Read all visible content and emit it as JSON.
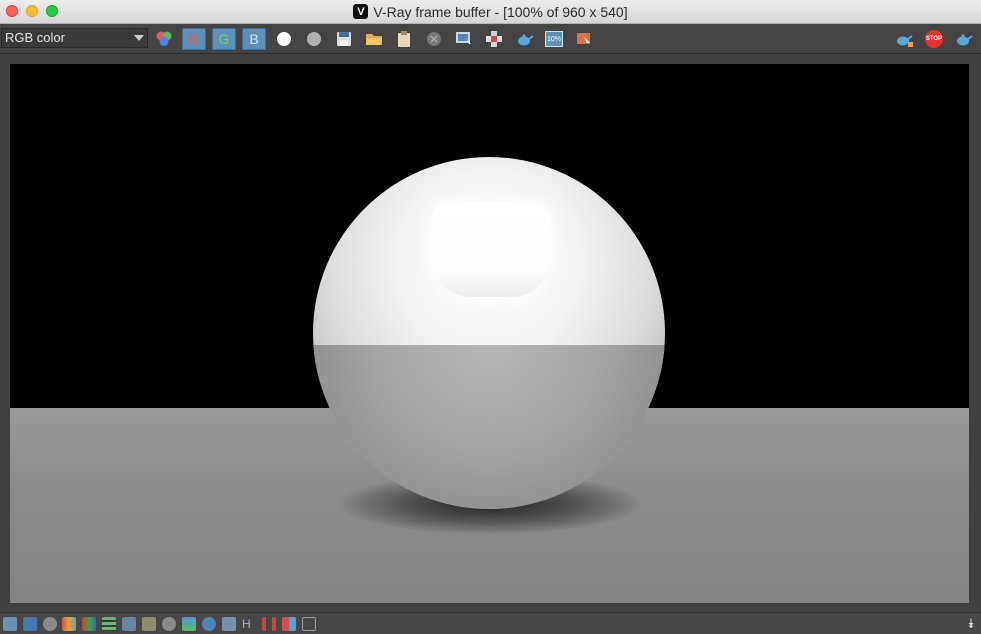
{
  "window": {
    "title": "V-Ray frame buffer - [100% of 960 x 540]",
    "logo_letter": "V"
  },
  "toolbar": {
    "channel_value": "RGB color",
    "red_label": "R",
    "green_label": "G",
    "blue_label": "B",
    "zoom_badge": "10%",
    "stop_label": "STOP"
  },
  "statusbar": {
    "expand_icon": "double-chevron-down-icon",
    "h_label": "H"
  },
  "colors": {
    "accent_blue": "#5f8fb6",
    "stop_red": "#e53030",
    "background": "#414141"
  }
}
